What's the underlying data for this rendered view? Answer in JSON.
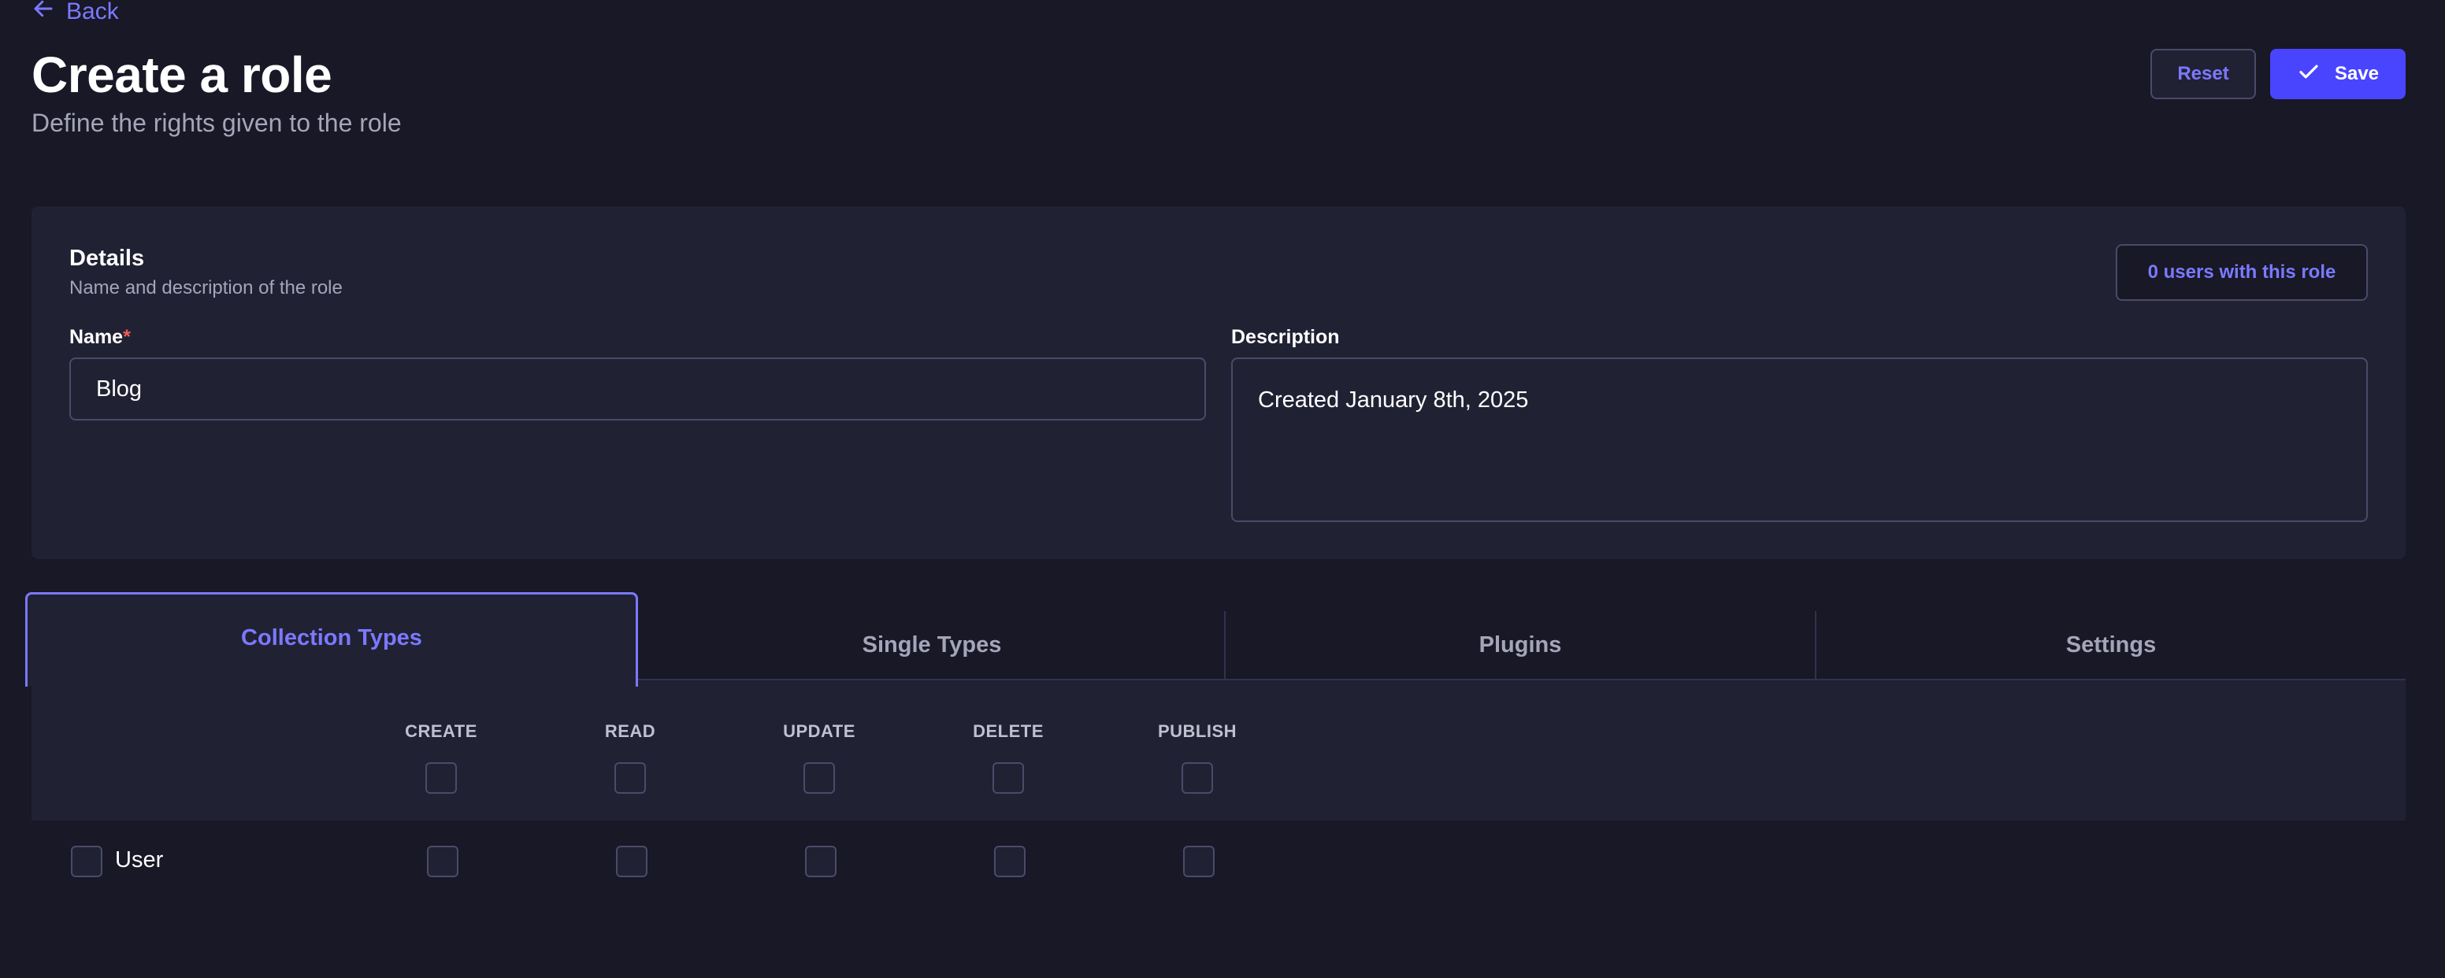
{
  "header": {
    "back_label": "Back",
    "title": "Create a role",
    "subtitle": "Define the rights given to the role",
    "reset_label": "Reset",
    "save_label": "Save"
  },
  "details": {
    "title": "Details",
    "subtitle": "Name and description of the role",
    "users_button": "0 users with this role",
    "name_label": "Name",
    "name_required": "*",
    "name_value": "Blog",
    "description_label": "Description",
    "description_value": "Created January 8th, 2025"
  },
  "tabs": [
    {
      "label": "Collection Types",
      "active": true
    },
    {
      "label": "Single Types",
      "active": false
    },
    {
      "label": "Plugins",
      "active": false
    },
    {
      "label": "Settings",
      "active": false
    }
  ],
  "permissions": {
    "columns": [
      "CREATE",
      "READ",
      "UPDATE",
      "DELETE",
      "PUBLISH"
    ],
    "rows": [
      {
        "label": "User",
        "checked": [
          false,
          false,
          false,
          false,
          false
        ]
      }
    ]
  },
  "colors": {
    "background": "#181826",
    "panel": "#212134",
    "accent": "#7b79ff",
    "primary": "#4945ff",
    "required": "#ee5e52"
  },
  "icons": {
    "back": "arrow-left-icon",
    "save": "check-icon"
  }
}
